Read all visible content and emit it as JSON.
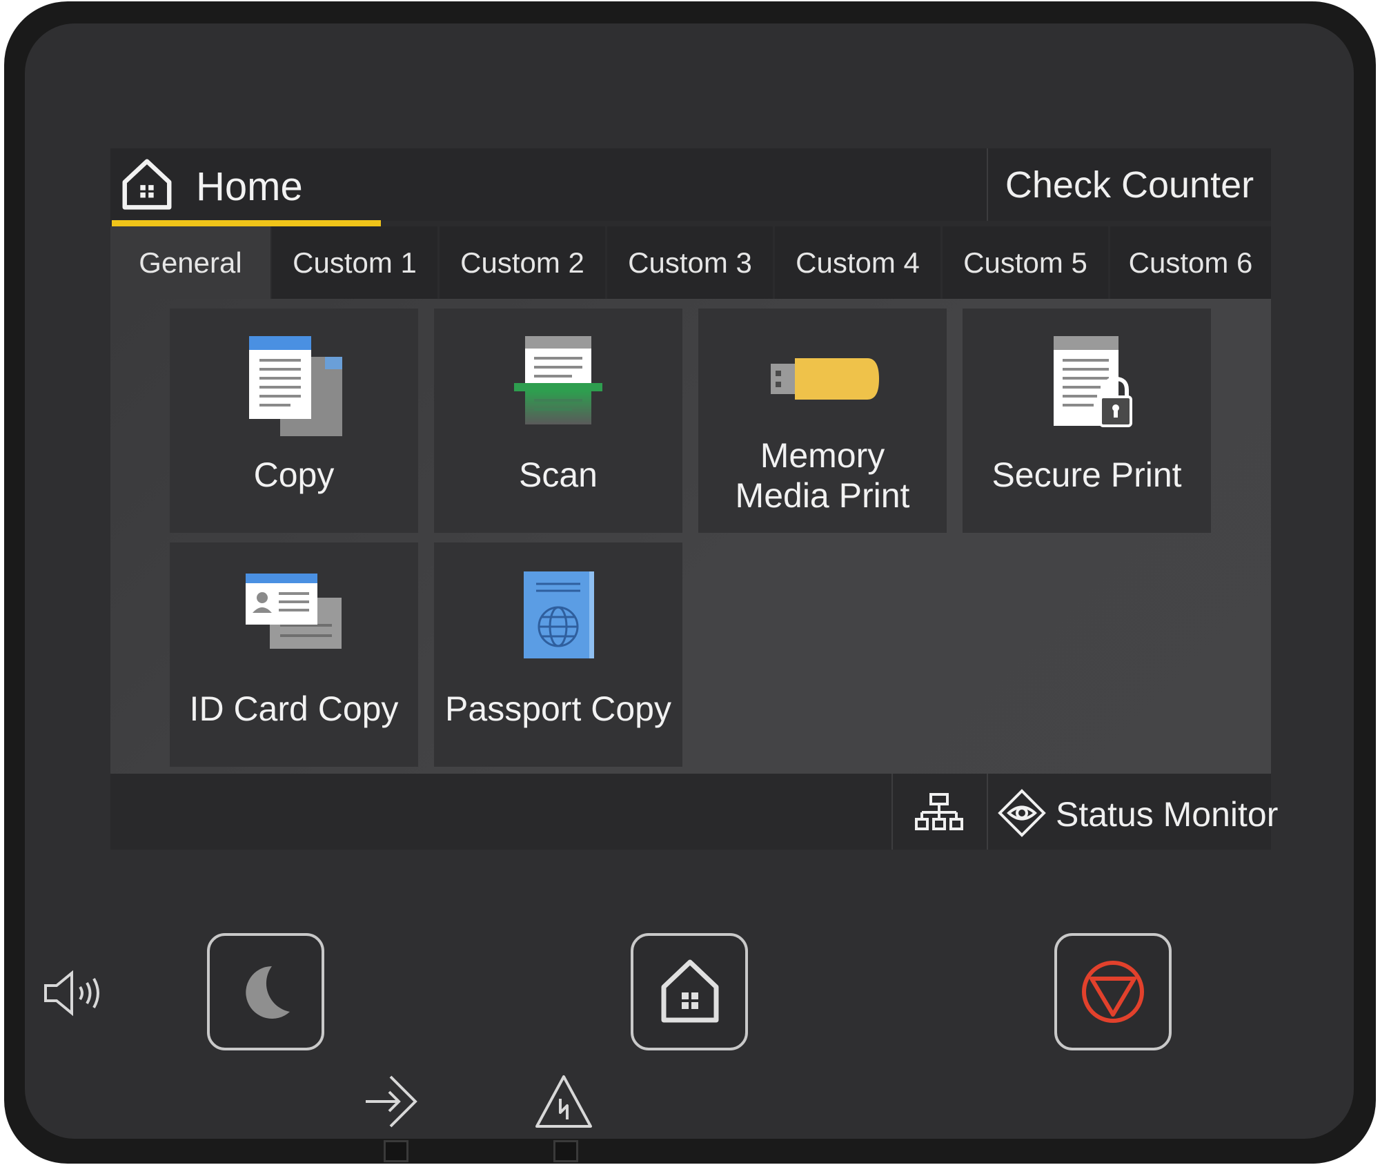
{
  "header": {
    "home_label": "Home",
    "check_counter_label": "Check Counter",
    "accent_color": "#f0c419"
  },
  "tabs": [
    {
      "label": "General",
      "active": true
    },
    {
      "label": "Custom 1"
    },
    {
      "label": "Custom 2"
    },
    {
      "label": "Custom 3"
    },
    {
      "label": "Custom 4"
    },
    {
      "label": "Custom 5"
    },
    {
      "label": "Custom 6"
    }
  ],
  "tiles": [
    {
      "label": "Copy",
      "icon": "copy-icon"
    },
    {
      "label": "Scan",
      "icon": "scan-icon"
    },
    {
      "label_line1": "Memory",
      "label_line2": "Media Print",
      "icon": "usb-memory-icon"
    },
    {
      "label": "Secure Print",
      "icon": "secure-print-lock-icon"
    },
    {
      "label": "ID Card Copy",
      "icon": "id-card-icon"
    },
    {
      "label": "Passport Copy",
      "icon": "passport-icon"
    }
  ],
  "status_bar": {
    "network_icon": "network-icon",
    "status_monitor_label": "Status Monitor",
    "status_monitor_icon": "eye-diamond-icon"
  },
  "hardware": {
    "sound_icon": "speaker-icon",
    "sleep_icon": "moon-icon",
    "home_icon": "home-icon",
    "stop_icon": "stop-icon",
    "stop_color": "#e2412c",
    "data_indicator_icon": "data-arrow-icon",
    "error_indicator_icon": "error-warning-icon"
  }
}
